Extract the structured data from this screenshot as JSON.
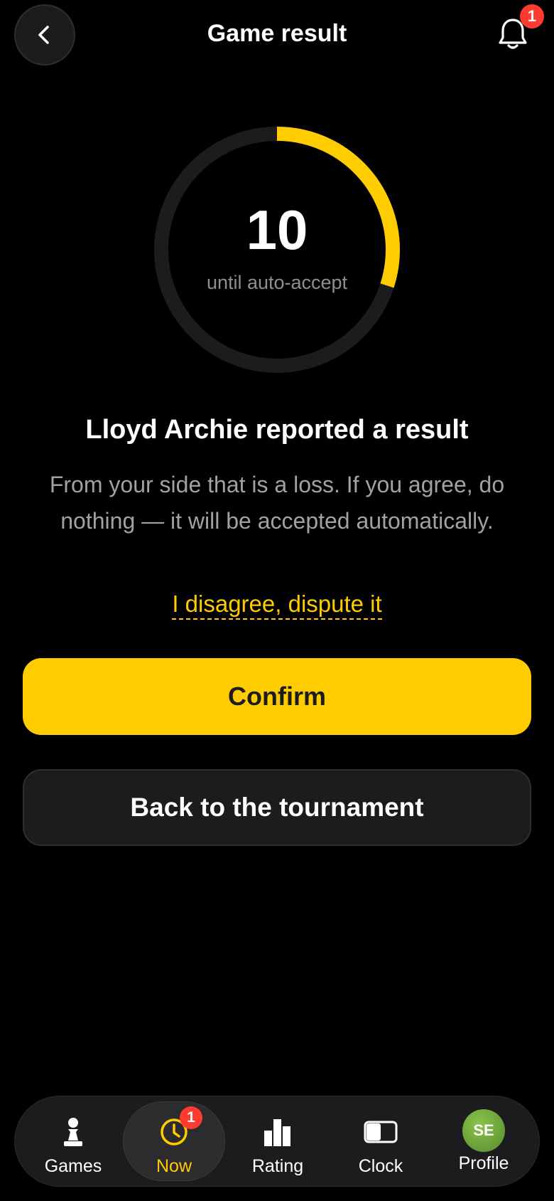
{
  "header": {
    "title": "Game result",
    "notification_count": "1"
  },
  "countdown": {
    "value": "10",
    "caption": "until auto-accept",
    "progress_fraction": 0.3,
    "accent_color": "#ffcc00"
  },
  "report": {
    "heading": "Lloyd Archie reported a result",
    "description": "From your side that is a loss. If you agree, do nothing — it will be accepted automatically.",
    "dispute_link": "I disagree, dispute it"
  },
  "actions": {
    "confirm_label": "Confirm",
    "back_label": "Back to the tournament"
  },
  "tabbar": {
    "items": [
      {
        "label": "Games",
        "icon": "pawn-icon"
      },
      {
        "label": "Now",
        "icon": "clock-icon",
        "badge": "1",
        "active": true
      },
      {
        "label": "Rating",
        "icon": "bar-chart-icon"
      },
      {
        "label": "Clock",
        "icon": "chess-clock-icon"
      },
      {
        "label": "Profile",
        "icon": "avatar",
        "initials": "SE"
      }
    ]
  }
}
